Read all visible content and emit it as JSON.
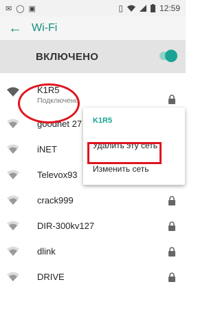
{
  "status_bar": {
    "left_icons": [
      "mail-icon",
      "whatsapp-icon",
      "image-icon"
    ],
    "right_icons": [
      "vibrate-icon",
      "wifi-icon",
      "signal-icon",
      "battery-icon"
    ],
    "time": "12:59"
  },
  "toolbar": {
    "title": "Wi-Fi"
  },
  "toggle": {
    "label": "ВКЛЮЧЕНО",
    "on": true
  },
  "networks": [
    {
      "name": "K1R5",
      "status": "Подключено",
      "locked": true,
      "connected": true
    },
    {
      "name": "goodnet 27",
      "locked": false
    },
    {
      "name": "iNET",
      "locked": false
    },
    {
      "name": "Televox93",
      "locked": true
    },
    {
      "name": "crack999",
      "locked": true
    },
    {
      "name": "DIR-300kv127",
      "locked": true
    },
    {
      "name": "dlink",
      "locked": true
    },
    {
      "name": "DRIVE",
      "locked": true
    }
  ],
  "context_menu": {
    "title": "K1R5",
    "items": [
      "Удалить эту сеть",
      "Изменить сеть"
    ]
  },
  "colors": {
    "accent": "#1aa395",
    "annotation": "#e0141e"
  }
}
